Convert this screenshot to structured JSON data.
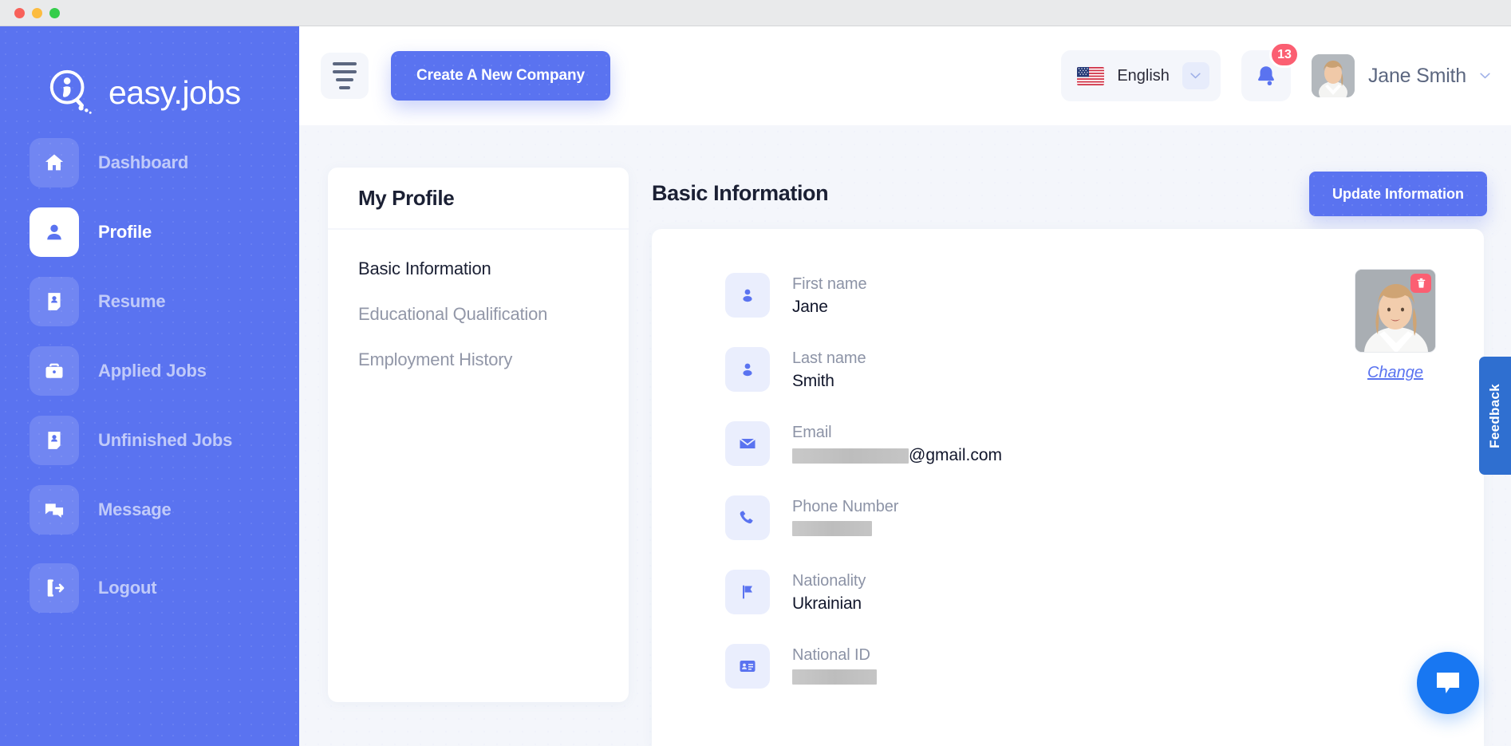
{
  "window": {
    "traffic_lights": [
      "close",
      "minimize",
      "maximize"
    ]
  },
  "brand": {
    "name": "easy.jobs",
    "logo_icon": "magnifier-person-logo"
  },
  "sidebar": {
    "items": [
      {
        "label": "Dashboard",
        "icon": "home-icon",
        "active": false
      },
      {
        "label": "Profile",
        "icon": "user-icon",
        "active": true
      },
      {
        "label": "Resume",
        "icon": "resume-icon",
        "active": false
      },
      {
        "label": "Applied Jobs",
        "icon": "briefcase-icon",
        "active": false
      },
      {
        "label": "Unfinished Jobs",
        "icon": "unfinished-resume-icon",
        "active": false
      },
      {
        "label": "Message",
        "icon": "chat-bubbles-icon",
        "active": false
      }
    ],
    "logout": {
      "label": "Logout",
      "icon": "logout-icon"
    }
  },
  "topbar": {
    "menu_toggle_icon": "hamburger-icon",
    "create_company_label": "Create A New Company",
    "language": {
      "label": "English",
      "flag_icon": "us-flag-icon",
      "chevron_icon": "chevron-down-icon"
    },
    "notifications": {
      "icon": "bell-icon",
      "count": "13"
    },
    "user": {
      "name": "Jane Smith",
      "avatar_icon": "user-avatar",
      "chevron_icon": "chevron-down-icon"
    }
  },
  "profile_card": {
    "title": "My Profile",
    "nav": [
      {
        "label": "Basic Information",
        "active": true
      },
      {
        "label": "Educational Qualification",
        "active": false
      },
      {
        "label": "Employment History",
        "active": false
      }
    ]
  },
  "main": {
    "section_title": "Basic Information",
    "update_button_label": "Update Information",
    "fields": [
      {
        "label": "First name",
        "value": "Jane",
        "icon": "user-icon",
        "redacted": false
      },
      {
        "label": "Last name",
        "value": "Smith",
        "icon": "user-icon",
        "redacted": false
      },
      {
        "label": "Email",
        "value": "@gmail.com",
        "icon": "envelope-icon",
        "redacted": true
      },
      {
        "label": "Phone Number",
        "value": "",
        "icon": "phone-icon",
        "redacted": true
      },
      {
        "label": "Nationality",
        "value": "Ukrainian",
        "icon": "flag-icon",
        "redacted": false
      },
      {
        "label": "National ID",
        "value": "",
        "icon": "id-card-icon",
        "redacted": true
      }
    ],
    "photo": {
      "change_label": "Change",
      "delete_icon": "trash-icon",
      "image_alt": "profile-photo"
    }
  },
  "feedback_tab": {
    "label": "Feedback"
  },
  "chat_widget": {
    "icon": "chat-bubble-icon"
  },
  "colors": {
    "brand_blue": "#5a73f0",
    "badge_red": "#fb5f72",
    "content_bg": "#f4f6fb",
    "text_dark": "#1b2034",
    "text_muted": "#8c93a6",
    "chat_blue": "#1877f2",
    "feedback_blue": "#2f6fd0"
  }
}
